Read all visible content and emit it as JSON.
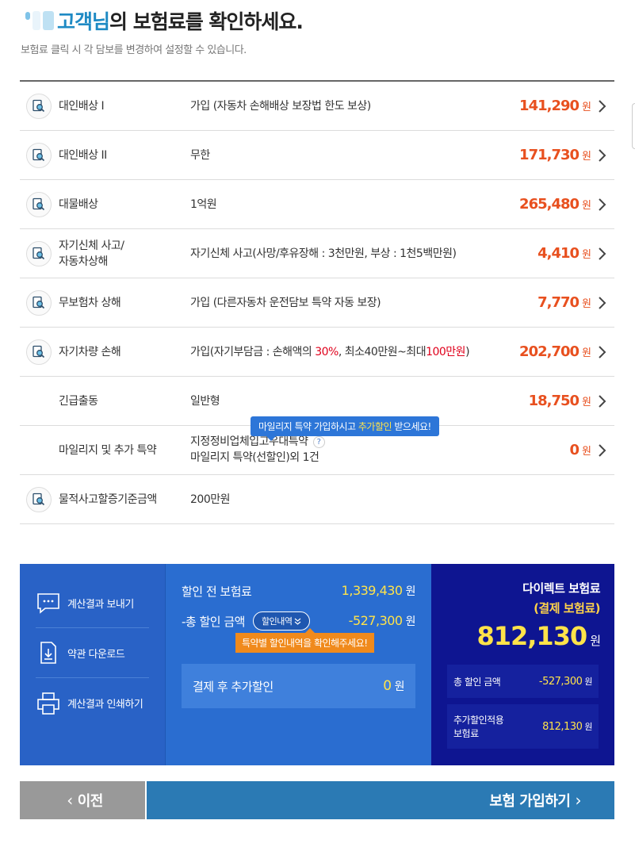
{
  "header": {
    "name_suffix": "고객님",
    "title_rest": "의 보험료를 확인하세요.",
    "subtitle": "보험료 클릭 시 각 담보를 변경하여 설정할 수 있습니다."
  },
  "coverages": [
    {
      "label": "대인배상 I",
      "desc": "가입 (자동차 손해배상 보장법 한도 보상)",
      "price": "141,290",
      "won": "원",
      "icon": "magnifier-doc-icon"
    },
    {
      "label": "대인배상 II",
      "desc": "무한",
      "price": "171,730",
      "won": "원",
      "icon": "magnifier-doc-icon"
    },
    {
      "label": "대물배상",
      "desc": "1억원",
      "price": "265,480",
      "won": "원",
      "icon": "magnifier-doc-icon"
    },
    {
      "label": "자기신체 사고/",
      "label2": "자동차상해",
      "desc": "자기신체 사고(사망/후유장해 : 3천만원, 부상 : 1천5백만원)",
      "price": "4,410",
      "won": "원",
      "icon": "magnifier-doc-icon"
    },
    {
      "label": "무보험차 상해",
      "desc": "가입 (다른자동차 운전담보 특약 자동 보장)",
      "price": "7,770",
      "won": "원",
      "icon": "magnifier-doc-icon"
    },
    {
      "label": "자기차량 손해",
      "desc_a": "가입(자기부담금 : 손해액의 ",
      "desc_b": "30%",
      "desc_c": ", 최소40만원~최대",
      "desc_d": "100만원",
      "desc_e": ")",
      "price": "202,700",
      "won": "원",
      "icon": "magnifier-doc-icon"
    },
    {
      "label": "긴급출동",
      "desc": "일반형",
      "price": "18,750",
      "won": "원"
    },
    {
      "label": "마일리지 및 추가 특약",
      "desc": "지정정비업체입고우대특약",
      "desc2": "마일리지 특약(선할인)외 1건",
      "qmark": "?",
      "price": "0",
      "won": "원"
    },
    {
      "label": "물적사고할증기준금액",
      "desc": "200만원",
      "icon": "magnifier-doc-icon"
    }
  ],
  "mileage_tip": {
    "a": "마일리지 특약 가입하시고 ",
    "b": "추가할인",
    "c": " 받으세요!"
  },
  "menu": [
    {
      "label": "계산결과 보내기",
      "icon": "chat-icon"
    },
    {
      "label": "약관 다운로드",
      "icon": "download-doc-icon"
    },
    {
      "label": "계산결과 인쇄하기",
      "icon": "printer-icon"
    }
  ],
  "summary": {
    "before_label": "할인 전 보험료",
    "before_value": "1,339,430",
    "discount_label": "-총 할인 금액",
    "discount_btn": "할인내역",
    "discount_value": "-527,300",
    "discount_tip": "특약별 할인내역을 확인해주세요!",
    "after_label": "결제 후 추가할인",
    "after_value": "0",
    "won": "원"
  },
  "direct": {
    "title": "다이렉트 보험료",
    "subtitle": "(결제 보험료)",
    "amount": "812,130",
    "won": "원",
    "total_disc_label": "총 할인 금액",
    "total_disc_value": "-527,300",
    "extra_label_1": "추가할인적용",
    "extra_label_2": "보험료",
    "extra_value": "812,130"
  },
  "buttons": {
    "prev": "이전",
    "join": "보험 가입하기"
  },
  "colors": {
    "accent_blue": "#1e8ac4",
    "price_orange": "#e8501f",
    "navy": "#0e1591",
    "mid_blue": "#2a6dd0",
    "yellow": "#ffe34a"
  }
}
